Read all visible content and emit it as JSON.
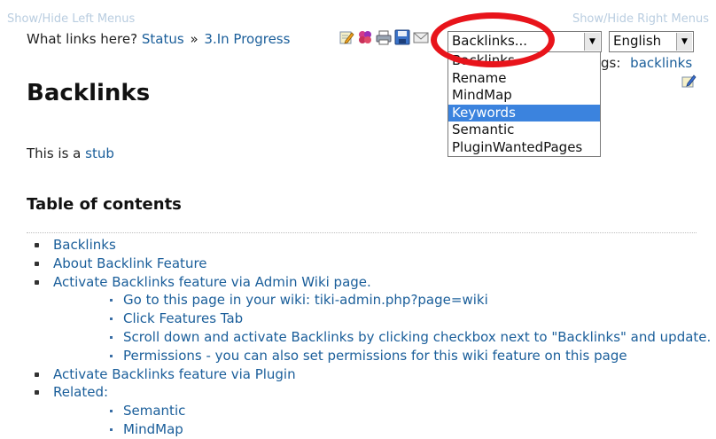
{
  "menus": {
    "show_hide_left": "Show/Hide Left Menus",
    "show_hide_right": "Show/Hide Right Menus"
  },
  "breadcrumb": {
    "label": "What links here?",
    "items": [
      "Status",
      "3.In Progress"
    ],
    "separator": "»"
  },
  "toolbar": {
    "icons": [
      "edit-icon",
      "structure-icon",
      "print-icon",
      "save-icon",
      "email-icon"
    ]
  },
  "actions_select": {
    "selected": "Backlinks...",
    "options": [
      "Backlinks",
      "Rename",
      "MindMap",
      "Keywords",
      "Semantic",
      "PluginWantedPages"
    ],
    "highlighted": "Keywords"
  },
  "language_select": {
    "selected": "English"
  },
  "tags": {
    "label": "gs:",
    "value": "backlinks"
  },
  "page": {
    "title": "Backlinks",
    "stub_prefix": "This is a",
    "stub_link": "stub"
  },
  "toc": {
    "title": "Table of contents",
    "items": [
      {
        "label": "Backlinks"
      },
      {
        "label": "About Backlink Feature"
      },
      {
        "label": "Activate Backlinks feature via Admin Wiki page.",
        "children": [
          "Go to this page in your wiki: tiki-admin.php?page=wiki",
          "Click Features Tab",
          "Scroll down and activate Backlinks by clicking checkbox next to \"Backlinks\" and update.",
          "Permissions - you can also set permissions for this wiki feature on this page"
        ]
      },
      {
        "label": "Activate Backlinks feature via Plugin"
      },
      {
        "label": "Related:",
        "children": [
          "Semantic",
          "MindMap"
        ]
      }
    ]
  },
  "colors": {
    "link": "#1a5e9a",
    "highlight_ring": "#e8141b",
    "option_highlight": "#3b83de"
  }
}
